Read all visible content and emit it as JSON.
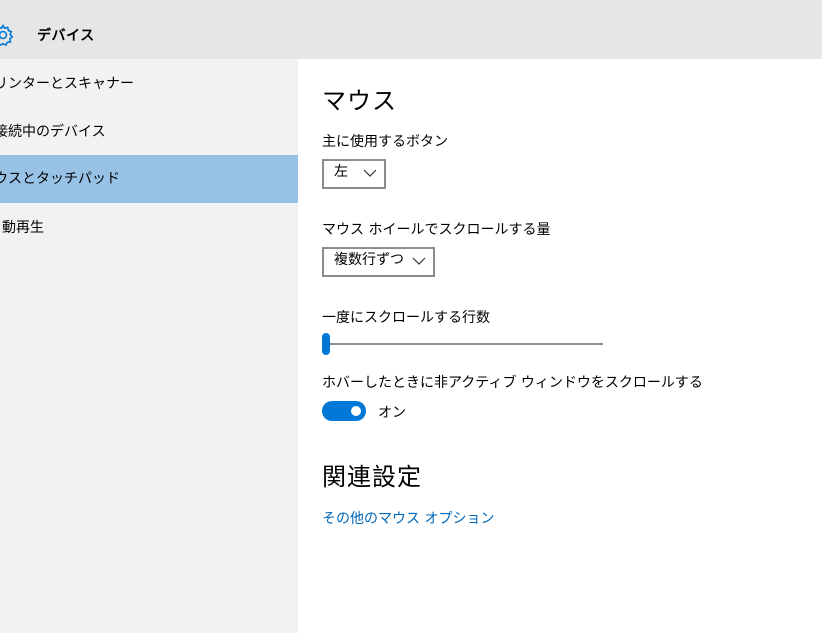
{
  "header": {
    "title": "デバイス",
    "icon": "gear-icon"
  },
  "sidebar": {
    "items": [
      {
        "label": "リンターとスキャナー"
      },
      {
        "label": "接続中のデバイス"
      },
      {
        "label": "ウスとタッチパッド",
        "selected": true
      },
      {
        "label": "動再生"
      }
    ]
  },
  "main": {
    "title": "マウス",
    "primary_button": {
      "label": "主に使用するボタン",
      "value": "左"
    },
    "scroll_amount": {
      "label": "マウス ホイールでスクロールする量",
      "value": "複数行ずつ"
    },
    "lines_to_scroll": {
      "label": "一度にスクロールする行数",
      "value_fraction": 0.0
    },
    "inactive_scroll": {
      "label": "ホバーしたときに非アクティブ ウィンドウをスクロールする",
      "state": "オン",
      "on": true
    },
    "related": {
      "title": "関連設定",
      "link": "その他のマウス オプション"
    }
  },
  "colors": {
    "accent": "#0078d7",
    "selected_bg": "#97c2e6",
    "link": "#0067b8"
  }
}
